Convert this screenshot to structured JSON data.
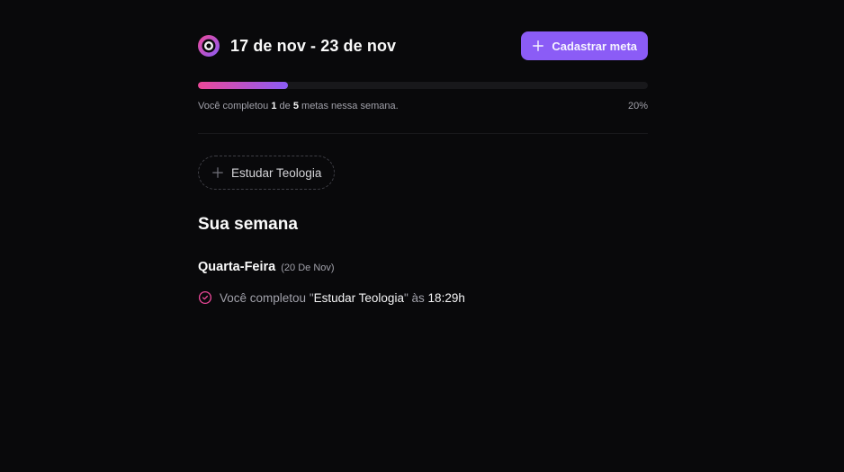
{
  "header": {
    "week_range": "17 de nov - 23 de nov",
    "create_goal_label": "Cadastrar meta"
  },
  "progress": {
    "completed": "1",
    "total": "5",
    "percent_label": "20%",
    "fraction": 0.2,
    "text_prefix": "Você completou",
    "text_of": "de",
    "text_suffix": "metas nessa semana."
  },
  "pending_goals": [
    {
      "title": "Estudar Teologia"
    }
  ],
  "summary": {
    "title": "Sua semana",
    "days": [
      {
        "weekday": "Quarta-Feira",
        "date": "(20 De Nov)",
        "completions": [
          {
            "prefix": "Você completou",
            "quote_open": "\"",
            "goal": "Estudar Teologia",
            "quote_close": "\"",
            "at": "às",
            "time": "18:29h"
          }
        ]
      }
    ]
  },
  "colors": {
    "background": "#09090b",
    "accent": "#8b5cf6",
    "pink": "#ec4899"
  },
  "icons": {
    "logo": "in-orbit-logo-icon",
    "add": "plus-icon",
    "completed": "circle-check-icon"
  }
}
